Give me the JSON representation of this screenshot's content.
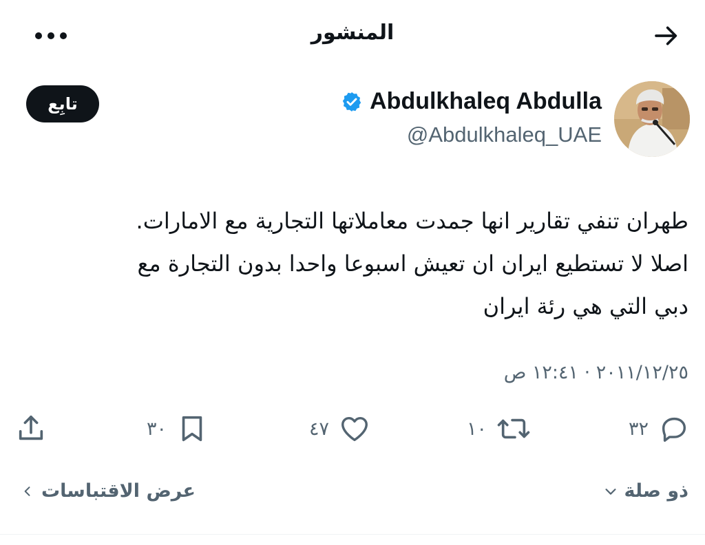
{
  "header": {
    "title": "المنشور",
    "back_icon": "arrow-right-icon",
    "more_icon": "more-horizontal-icon"
  },
  "author": {
    "display_name": "Abdulkhaleq Abdulla",
    "handle": "@Abdulkhaleq_UAE",
    "verified_color": "#1d9bf0",
    "follow_label": "تابِع"
  },
  "tweet": {
    "lines": [
      "طهران تنفي تقارير انها جمدت معاملاتها التجارية مع الامارات.",
      "اصلا لا تستطيع ايران ان تعيش اسبوعا واحدا بدون التجارة مع",
      "دبي التي هي رئة ايران"
    ],
    "timestamp": "٢٠١١/١٢/٢٥ · ١٢:٤١ ص"
  },
  "actions": {
    "replies": "٣٢",
    "retweets": "١٠",
    "likes": "٤٧",
    "bookmarks": "٣٠"
  },
  "footer": {
    "reply_setting_label": "ذو صلة",
    "quotes_label": "عرض الاقتباسات"
  },
  "colors": {
    "text_primary": "#0f1419",
    "text_secondary": "#536471",
    "accent": "#1d9bf0"
  }
}
